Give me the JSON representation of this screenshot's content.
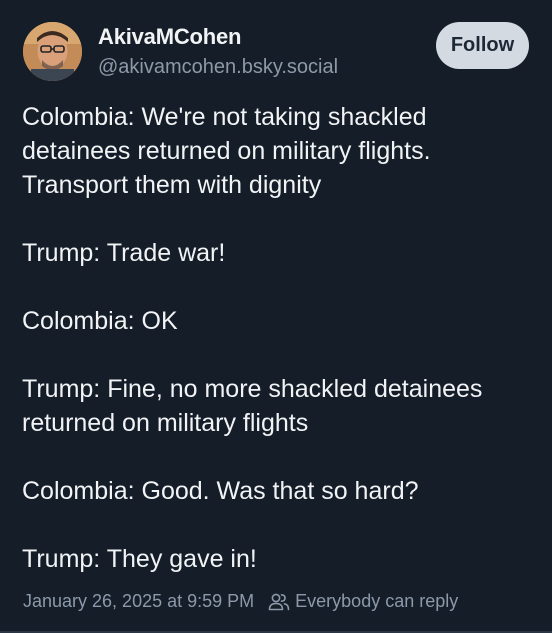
{
  "author": {
    "display_name": "AkivaMCohen",
    "handle": "@akivamcohen.bsky.social"
  },
  "follow_label": "Follow",
  "post": {
    "paragraphs": [
      "Colombia: We're not taking shackled detainees returned on military flights. Transport them with dignity",
      "Trump: Trade war!",
      "Colombia: OK",
      "Trump: Fine, no more shackled detainees returned on military flights",
      "Colombia: Good. Was that so hard?",
      "Trump: They gave in!"
    ],
    "timestamp": "January 26, 2025 at 9:59 PM",
    "reply_setting": "Everybody can reply",
    "reply_icon": "people-icon"
  },
  "colors": {
    "background": "#151d28",
    "text": "#f1f3f5",
    "muted": "#8c99aa",
    "follow_bg": "#d4dae1"
  }
}
